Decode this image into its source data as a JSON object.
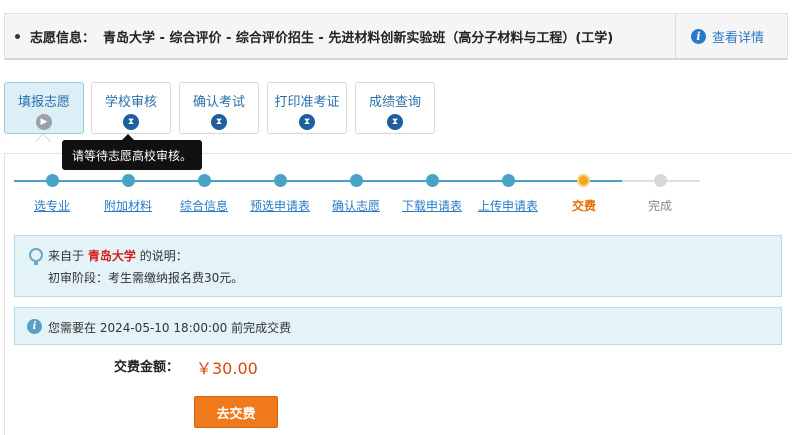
{
  "header": {
    "info_label": "志愿信息：",
    "info_text": "青岛大学 - 综合评价 - 综合评价招生 - 先进材料创新实验班（高分子材料与工程）(工学)",
    "detail_link": "查看详情",
    "detail_icon": "info-icon"
  },
  "tabs": [
    {
      "label": "填报志愿",
      "icon": "play-icon",
      "active": true
    },
    {
      "label": "学校审核",
      "icon": "hourglass-icon",
      "active": false
    },
    {
      "label": "确认考试",
      "icon": "hourglass-icon",
      "active": false
    },
    {
      "label": "打印准考证",
      "icon": "hourglass-icon",
      "active": false
    },
    {
      "label": "成绩查询",
      "icon": "hourglass-icon",
      "active": false
    }
  ],
  "tooltip": "请等待志愿高校审核。",
  "steps": [
    {
      "label": "选专业",
      "state": "done"
    },
    {
      "label": "附加材料",
      "state": "done"
    },
    {
      "label": "综合信息",
      "state": "done"
    },
    {
      "label": "预选申请表",
      "state": "done"
    },
    {
      "label": "确认志愿",
      "state": "done"
    },
    {
      "label": "下载申请表",
      "state": "done"
    },
    {
      "label": "上传申请表",
      "state": "done"
    },
    {
      "label": "交费",
      "state": "current"
    },
    {
      "label": "完成",
      "state": "pending"
    }
  ],
  "notice1": {
    "prefix": "来自于",
    "school": "青岛大学",
    "suffix": "的说明：",
    "detail": "初审阶段：考生需缴纳报名费30元。"
  },
  "notice2": {
    "text": "您需要在 2024-05-10 18:00:00 前完成交费"
  },
  "fee": {
    "label": "交费金额：",
    "amount": "￥30.00"
  },
  "pay_button": "去交费",
  "colors": {
    "accent": "#2a7bc6",
    "step": "#4aa3c6",
    "current": "#f5a623",
    "button": "#f07a1b",
    "school": "#d0211c"
  }
}
